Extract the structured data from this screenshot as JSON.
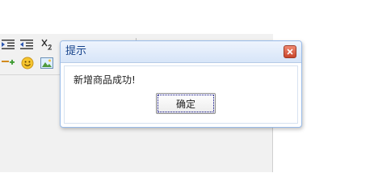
{
  "dialog": {
    "title": "提示",
    "message": "新增商品成功!",
    "ok_label": "确定"
  },
  "toolbar": {
    "icons": [
      "indent-icon",
      "outdent-icon",
      "subscript-icon",
      "arrow-plus-icon",
      "smiley-icon",
      "image-icon"
    ],
    "accent": "#99bbe8",
    "title_color": "#15428b"
  }
}
